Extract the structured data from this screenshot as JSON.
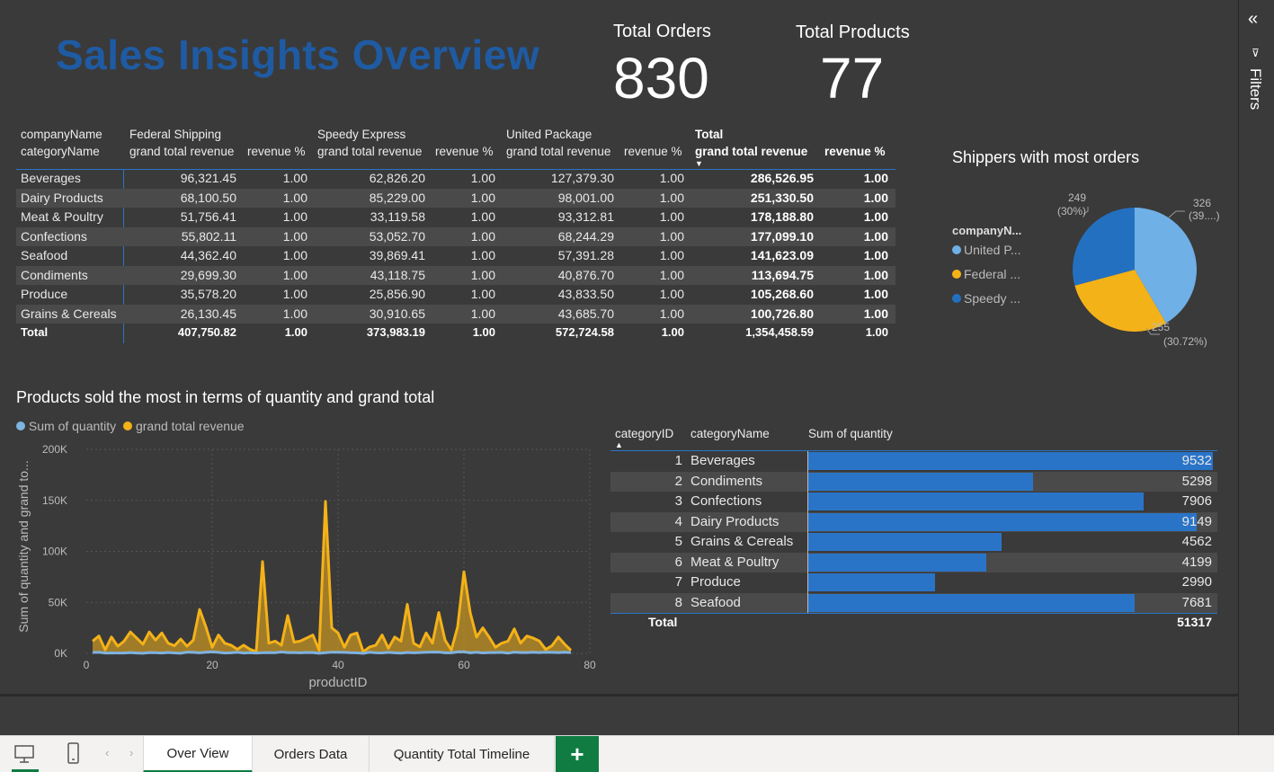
{
  "page": {
    "title": "Sales Insights Overview",
    "cards": [
      {
        "label": "Total Orders",
        "value": "830"
      },
      {
        "label": "Total Products",
        "value": "77"
      }
    ]
  },
  "matrix": {
    "row_header_1": "companyName",
    "row_header_2": "categoryName",
    "groups": [
      {
        "name": "Federal Shipping",
        "col1": "grand total revenue",
        "col2": "revenue %"
      },
      {
        "name": "Speedy Express",
        "col1": "grand total revenue",
        "col2": "revenue %"
      },
      {
        "name": "United Package",
        "col1": "grand total revenue",
        "col2": "revenue %"
      },
      {
        "name": "Total",
        "col1": "grand total revenue",
        "col2": "revenue %"
      }
    ],
    "rows": [
      {
        "category": "Beverages",
        "cells": [
          "96,321.45",
          "1.00",
          "62,826.20",
          "1.00",
          "127,379.30",
          "1.00",
          "286,526.95",
          "1.00"
        ]
      },
      {
        "category": "Dairy Products",
        "cells": [
          "68,100.50",
          "1.00",
          "85,229.00",
          "1.00",
          "98,001.00",
          "1.00",
          "251,330.50",
          "1.00"
        ]
      },
      {
        "category": "Meat & Poultry",
        "cells": [
          "51,756.41",
          "1.00",
          "33,119.58",
          "1.00",
          "93,312.81",
          "1.00",
          "178,188.80",
          "1.00"
        ]
      },
      {
        "category": "Confections",
        "cells": [
          "55,802.11",
          "1.00",
          "53,052.70",
          "1.00",
          "68,244.29",
          "1.00",
          "177,099.10",
          "1.00"
        ]
      },
      {
        "category": "Seafood",
        "cells": [
          "44,362.40",
          "1.00",
          "39,869.41",
          "1.00",
          "57,391.28",
          "1.00",
          "141,623.09",
          "1.00"
        ]
      },
      {
        "category": "Condiments",
        "cells": [
          "29,699.30",
          "1.00",
          "43,118.75",
          "1.00",
          "40,876.70",
          "1.00",
          "113,694.75",
          "1.00"
        ]
      },
      {
        "category": "Produce",
        "cells": [
          "35,578.20",
          "1.00",
          "25,856.90",
          "1.00",
          "43,833.50",
          "1.00",
          "105,268.60",
          "1.00"
        ]
      },
      {
        "category": "Grains & Cereals",
        "cells": [
          "26,130.45",
          "1.00",
          "30,910.65",
          "1.00",
          "43,685.70",
          "1.00",
          "100,726.80",
          "1.00"
        ]
      }
    ],
    "total_row": {
      "category": "Total",
      "cells": [
        "407,750.82",
        "1.00",
        "373,983.19",
        "1.00",
        "572,724.58",
        "1.00",
        "1,354,458.59",
        "1.00"
      ]
    }
  },
  "pie": {
    "title": "Shippers with most orders",
    "legend_title": "companyN...",
    "legend": [
      {
        "label": "United P...",
        "color": "#6fb0e6"
      },
      {
        "label": "Federal ...",
        "color": "#f4b219"
      },
      {
        "label": "Speedy ...",
        "color": "#2470c0"
      }
    ],
    "labels": [
      {
        "value": "326",
        "pct": "(39....)"
      },
      {
        "value": "255",
        "pct": "(30.72%)"
      },
      {
        "value": "249",
        "pct": "(30%)"
      }
    ]
  },
  "line_chart": {
    "title": "Products sold the most in terms of quantity and grand total",
    "legend": [
      {
        "label": "Sum of quantity",
        "color": "#7fb3e0"
      },
      {
        "label": "grand total revenue",
        "color": "#f4b219"
      }
    ],
    "ylabel": "Sum of quantity and grand to...",
    "xlabel": "productID",
    "yticks": [
      "200K",
      "150K",
      "100K",
      "50K",
      "0K"
    ],
    "xticks": [
      "0",
      "20",
      "40",
      "60",
      "80"
    ]
  },
  "chart_data": {
    "type": "area",
    "xlabel": "productID",
    "ylabel": "Sum of quantity and grand to...",
    "xlim": [
      0,
      80
    ],
    "ylim": [
      0,
      200000
    ],
    "x": [
      1,
      2,
      3,
      4,
      5,
      6,
      7,
      8,
      9,
      10,
      11,
      12,
      13,
      14,
      15,
      16,
      17,
      18,
      19,
      20,
      21,
      22,
      23,
      24,
      25,
      26,
      27,
      28,
      29,
      30,
      31,
      32,
      33,
      34,
      35,
      36,
      37,
      38,
      39,
      40,
      41,
      42,
      43,
      44,
      45,
      46,
      47,
      48,
      49,
      50,
      51,
      52,
      53,
      54,
      55,
      56,
      57,
      58,
      59,
      60,
      61,
      62,
      63,
      64,
      65,
      66,
      67,
      68,
      69,
      70,
      71,
      72,
      73,
      74,
      75,
      76,
      77
    ],
    "series": [
      {
        "name": "grand total revenue",
        "values": [
          12000,
          17000,
          3500,
          16000,
          7000,
          12000,
          21000,
          15000,
          9000,
          21000,
          13000,
          20000,
          10000,
          7500,
          14000,
          7000,
          13000,
          43000,
          26000,
          6000,
          18000,
          10000,
          8000,
          4000,
          8000,
          4000,
          1700,
          90000,
          10000,
          12000,
          8000,
          37000,
          11000,
          12000,
          15000,
          18000,
          3000,
          149000,
          25000,
          20000,
          6000,
          18000,
          20000,
          1500,
          6200,
          8000,
          18000,
          5000,
          16000,
          12000,
          48000,
          10000,
          6400,
          20000,
          10000,
          40000,
          13000,
          3300,
          26000,
          80000,
          40000,
          16000,
          25000,
          16000,
          6000,
          10000,
          12000,
          24000,
          10000,
          17000,
          15000,
          12000,
          3800,
          7600,
          16000,
          9000,
          3000
        ]
      },
      {
        "name": "Sum of quantity",
        "values": [
          828,
          1057,
          328,
          453,
          298,
          301,
          763,
          372,
          95,
          742,
          706,
          344,
          891,
          404,
          122,
          1158,
          978,
          539,
          1083,
          1577,
          1016,
          348,
          580,
          1125,
          318,
          623,
          365,
          640,
          746,
          612,
          1397,
          791,
          755,
          506,
          883,
          805,
          125,
          623,
          1155,
          1103,
          981,
          697,
          580,
          10,
          1085,
          548,
          485,
          1002,
          520,
          235,
          886,
          500,
          722,
          1067,
          1263,
          1263,
          603,
          534,
          1496,
          1577,
          603,
          1057,
          445,
          740,
          745,
          980,
          184,
          1242,
          738,
          817,
          1057,
          722,
          1076,
          1039,
          816,
          1097,
          791
        ]
      }
    ]
  },
  "qtable": {
    "headers": [
      "categoryID",
      "categoryName",
      "Sum of quantity"
    ],
    "max": 9532,
    "rows": [
      {
        "id": "1",
        "name": "Beverages",
        "qty": 9532
      },
      {
        "id": "2",
        "name": "Condiments",
        "qty": 5298
      },
      {
        "id": "3",
        "name": "Confections",
        "qty": 7906
      },
      {
        "id": "4",
        "name": "Dairy Products",
        "qty": 9149
      },
      {
        "id": "5",
        "name": "Grains & Cereals",
        "qty": 4562
      },
      {
        "id": "6",
        "name": "Meat & Poultry",
        "qty": 4199
      },
      {
        "id": "7",
        "name": "Produce",
        "qty": 2990
      },
      {
        "id": "8",
        "name": "Seafood",
        "qty": 7681
      }
    ],
    "total_label": "Total",
    "total_value": "51317"
  },
  "filters": {
    "label": "Filters"
  },
  "tabs": [
    {
      "label": "Over View",
      "active": true
    },
    {
      "label": "Orders Data",
      "active": false
    },
    {
      "label": "Quantity Total Timeline",
      "active": false
    }
  ],
  "colors": {
    "accent": "#1f5ba3",
    "bar": "#2a74c8",
    "tab_green": "#107c41"
  }
}
